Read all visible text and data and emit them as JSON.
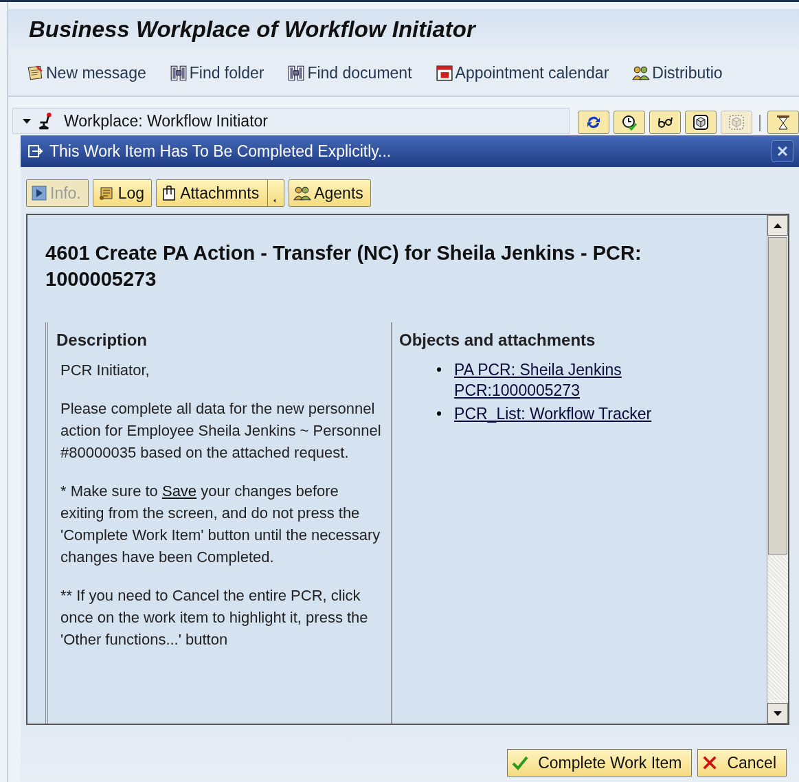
{
  "window": {
    "title": "Business Workplace of Workflow Initiator"
  },
  "toolbar": [
    {
      "label": "New message"
    },
    {
      "label": "Find folder"
    },
    {
      "label": "Find document"
    },
    {
      "label": "Appointment calendar"
    },
    {
      "label": "Distributio"
    }
  ],
  "workplace": {
    "label": "Workplace: Workflow Initiator",
    "expanded": true,
    "tools": [
      {
        "disabled": false
      },
      {
        "disabled": false
      },
      {
        "disabled": false
      },
      {
        "disabled": false
      },
      {
        "disabled": true
      },
      {
        "disabled": false
      }
    ]
  },
  "dialog": {
    "title": "This Work Item Has To Be Completed Explicitly...",
    "tabs": [
      {
        "label": "Info.",
        "disabled": true,
        "dropdown": false
      },
      {
        "label": "Log",
        "disabled": false,
        "dropdown": false
      },
      {
        "label": "Attachmnts",
        "disabled": false,
        "dropdown": true
      },
      {
        "label": "Agents",
        "disabled": false,
        "dropdown": false
      }
    ],
    "heading": "4601 Create PA Action - Transfer (NC) for Sheila Jenkins - PCR: 1000005273",
    "description": {
      "title": "Description",
      "paragraphs": [
        [
          {
            "text": "PCR Initiator,",
            "link": false
          }
        ],
        [
          {
            "text": "Please complete all data for the new personnel action for Employee Sheila Jenkins ~ Personnel #80000035 based on the attached request.",
            "link": false
          }
        ],
        [
          {
            "text": "* Make sure to ",
            "link": false
          },
          {
            "text": "Save",
            "link": true
          },
          {
            "text": " your changes before exiting from the screen, and do not press the 'Complete Work Item' button until the necessary changes have been Completed.",
            "link": false
          }
        ],
        [
          {
            "text": "** If you need to Cancel the entire PCR, click once on the work item to highlight it, press the 'Other functions...' button",
            "link": false
          }
        ]
      ]
    },
    "objects": {
      "title": "Objects and attachments",
      "links": [
        {
          "bullet": "•",
          "text": "PA PCR: Sheila Jenkins PCR:1000005273"
        },
        {
          "bullet": "•",
          "text": "PCR_List: Workflow Tracker"
        }
      ]
    },
    "buttons": [
      {
        "label": "Complete Work Item"
      },
      {
        "label": "Cancel"
      }
    ]
  }
}
